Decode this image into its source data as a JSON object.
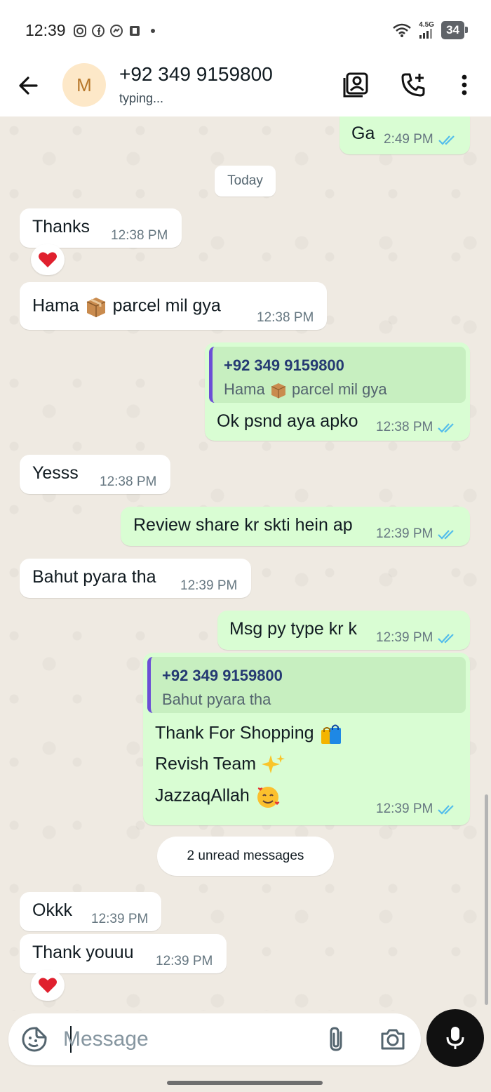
{
  "status_bar": {
    "time": "12:39",
    "network": "4.5G",
    "battery": "34"
  },
  "header": {
    "avatar_letter": "M",
    "contact_name": "+92 349 9159800",
    "status": "typing..."
  },
  "chat": {
    "date_chip": "Today",
    "unread_chip": "2 unread messages",
    "messages": [
      {
        "dir": "out",
        "text": "Ga",
        "time": "2:49 PM"
      },
      {
        "dir": "in",
        "text": "Thanks",
        "time": "12:38 PM",
        "reaction": "heart"
      },
      {
        "dir": "in",
        "text_before": "Hama",
        "emoji": "package",
        "text_after": "parcel mil gya",
        "time": "12:38 PM"
      },
      {
        "dir": "out",
        "quote_name": "+92 349 9159800",
        "quote_before": "Hama",
        "quote_emoji": "package",
        "quote_after": "parcel mil gya",
        "text": "Ok psnd aya apko",
        "time": "12:38 PM"
      },
      {
        "dir": "in",
        "text": "Yesss",
        "time": "12:38 PM"
      },
      {
        "dir": "out",
        "text": "Review share kr skti hein ap",
        "time": "12:39 PM"
      },
      {
        "dir": "in",
        "text": "Bahut pyara tha",
        "time": "12:39 PM"
      },
      {
        "dir": "out",
        "text": "Msg py type kr k",
        "time": "12:39 PM"
      },
      {
        "dir": "out",
        "quote_name": "+92 349 9159800",
        "quote_text": "Bahut pyara tha",
        "line1": "Thank For  Shopping",
        "line1_emoji": "shopping-bags",
        "line2": "Revish  Team",
        "line2_emoji": "sparkles",
        "line3": "JazzaqAllah",
        "line3_emoji": "smiling-face-with-hearts",
        "time": "12:39 PM"
      },
      {
        "dir": "in",
        "text": "Okkk",
        "time": "12:39 PM"
      },
      {
        "dir": "in",
        "text": "Thank youuu",
        "time": "12:39 PM",
        "reaction": "heart"
      }
    ]
  },
  "input": {
    "placeholder": "Message"
  },
  "colors": {
    "incoming": "#ffffff",
    "outgoing": "#d9fdd3",
    "tick_blue": "#53bdeb",
    "chat_bg": "#efeae2"
  }
}
